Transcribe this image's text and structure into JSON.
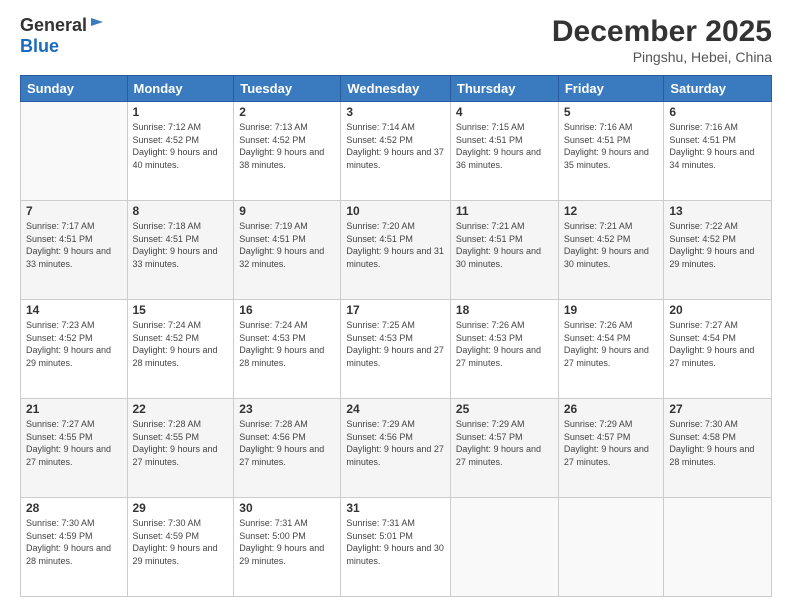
{
  "header": {
    "logo": {
      "general": "General",
      "blue": "Blue"
    },
    "title": "December 2025",
    "location": "Pingshu, Hebei, China"
  },
  "days_of_week": [
    "Sunday",
    "Monday",
    "Tuesday",
    "Wednesday",
    "Thursday",
    "Friday",
    "Saturday"
  ],
  "weeks": [
    [
      {
        "day": "",
        "sunrise": "",
        "sunset": "",
        "daylight": ""
      },
      {
        "day": "1",
        "sunrise": "Sunrise: 7:12 AM",
        "sunset": "Sunset: 4:52 PM",
        "daylight": "Daylight: 9 hours and 40 minutes."
      },
      {
        "day": "2",
        "sunrise": "Sunrise: 7:13 AM",
        "sunset": "Sunset: 4:52 PM",
        "daylight": "Daylight: 9 hours and 38 minutes."
      },
      {
        "day": "3",
        "sunrise": "Sunrise: 7:14 AM",
        "sunset": "Sunset: 4:52 PM",
        "daylight": "Daylight: 9 hours and 37 minutes."
      },
      {
        "day": "4",
        "sunrise": "Sunrise: 7:15 AM",
        "sunset": "Sunset: 4:51 PM",
        "daylight": "Daylight: 9 hours and 36 minutes."
      },
      {
        "day": "5",
        "sunrise": "Sunrise: 7:16 AM",
        "sunset": "Sunset: 4:51 PM",
        "daylight": "Daylight: 9 hours and 35 minutes."
      },
      {
        "day": "6",
        "sunrise": "Sunrise: 7:16 AM",
        "sunset": "Sunset: 4:51 PM",
        "daylight": "Daylight: 9 hours and 34 minutes."
      }
    ],
    [
      {
        "day": "7",
        "sunrise": "Sunrise: 7:17 AM",
        "sunset": "Sunset: 4:51 PM",
        "daylight": "Daylight: 9 hours and 33 minutes."
      },
      {
        "day": "8",
        "sunrise": "Sunrise: 7:18 AM",
        "sunset": "Sunset: 4:51 PM",
        "daylight": "Daylight: 9 hours and 33 minutes."
      },
      {
        "day": "9",
        "sunrise": "Sunrise: 7:19 AM",
        "sunset": "Sunset: 4:51 PM",
        "daylight": "Daylight: 9 hours and 32 minutes."
      },
      {
        "day": "10",
        "sunrise": "Sunrise: 7:20 AM",
        "sunset": "Sunset: 4:51 PM",
        "daylight": "Daylight: 9 hours and 31 minutes."
      },
      {
        "day": "11",
        "sunrise": "Sunrise: 7:21 AM",
        "sunset": "Sunset: 4:51 PM",
        "daylight": "Daylight: 9 hours and 30 minutes."
      },
      {
        "day": "12",
        "sunrise": "Sunrise: 7:21 AM",
        "sunset": "Sunset: 4:52 PM",
        "daylight": "Daylight: 9 hours and 30 minutes."
      },
      {
        "day": "13",
        "sunrise": "Sunrise: 7:22 AM",
        "sunset": "Sunset: 4:52 PM",
        "daylight": "Daylight: 9 hours and 29 minutes."
      }
    ],
    [
      {
        "day": "14",
        "sunrise": "Sunrise: 7:23 AM",
        "sunset": "Sunset: 4:52 PM",
        "daylight": "Daylight: 9 hours and 29 minutes."
      },
      {
        "day": "15",
        "sunrise": "Sunrise: 7:24 AM",
        "sunset": "Sunset: 4:52 PM",
        "daylight": "Daylight: 9 hours and 28 minutes."
      },
      {
        "day": "16",
        "sunrise": "Sunrise: 7:24 AM",
        "sunset": "Sunset: 4:53 PM",
        "daylight": "Daylight: 9 hours and 28 minutes."
      },
      {
        "day": "17",
        "sunrise": "Sunrise: 7:25 AM",
        "sunset": "Sunset: 4:53 PM",
        "daylight": "Daylight: 9 hours and 27 minutes."
      },
      {
        "day": "18",
        "sunrise": "Sunrise: 7:26 AM",
        "sunset": "Sunset: 4:53 PM",
        "daylight": "Daylight: 9 hours and 27 minutes."
      },
      {
        "day": "19",
        "sunrise": "Sunrise: 7:26 AM",
        "sunset": "Sunset: 4:54 PM",
        "daylight": "Daylight: 9 hours and 27 minutes."
      },
      {
        "day": "20",
        "sunrise": "Sunrise: 7:27 AM",
        "sunset": "Sunset: 4:54 PM",
        "daylight": "Daylight: 9 hours and 27 minutes."
      }
    ],
    [
      {
        "day": "21",
        "sunrise": "Sunrise: 7:27 AM",
        "sunset": "Sunset: 4:55 PM",
        "daylight": "Daylight: 9 hours and 27 minutes."
      },
      {
        "day": "22",
        "sunrise": "Sunrise: 7:28 AM",
        "sunset": "Sunset: 4:55 PM",
        "daylight": "Daylight: 9 hours and 27 minutes."
      },
      {
        "day": "23",
        "sunrise": "Sunrise: 7:28 AM",
        "sunset": "Sunset: 4:56 PM",
        "daylight": "Daylight: 9 hours and 27 minutes."
      },
      {
        "day": "24",
        "sunrise": "Sunrise: 7:29 AM",
        "sunset": "Sunset: 4:56 PM",
        "daylight": "Daylight: 9 hours and 27 minutes."
      },
      {
        "day": "25",
        "sunrise": "Sunrise: 7:29 AM",
        "sunset": "Sunset: 4:57 PM",
        "daylight": "Daylight: 9 hours and 27 minutes."
      },
      {
        "day": "26",
        "sunrise": "Sunrise: 7:29 AM",
        "sunset": "Sunset: 4:57 PM",
        "daylight": "Daylight: 9 hours and 27 minutes."
      },
      {
        "day": "27",
        "sunrise": "Sunrise: 7:30 AM",
        "sunset": "Sunset: 4:58 PM",
        "daylight": "Daylight: 9 hours and 28 minutes."
      }
    ],
    [
      {
        "day": "28",
        "sunrise": "Sunrise: 7:30 AM",
        "sunset": "Sunset: 4:59 PM",
        "daylight": "Daylight: 9 hours and 28 minutes."
      },
      {
        "day": "29",
        "sunrise": "Sunrise: 7:30 AM",
        "sunset": "Sunset: 4:59 PM",
        "daylight": "Daylight: 9 hours and 29 minutes."
      },
      {
        "day": "30",
        "sunrise": "Sunrise: 7:31 AM",
        "sunset": "Sunset: 5:00 PM",
        "daylight": "Daylight: 9 hours and 29 minutes."
      },
      {
        "day": "31",
        "sunrise": "Sunrise: 7:31 AM",
        "sunset": "Sunset: 5:01 PM",
        "daylight": "Daylight: 9 hours and 30 minutes."
      },
      {
        "day": "",
        "sunrise": "",
        "sunset": "",
        "daylight": ""
      },
      {
        "day": "",
        "sunrise": "",
        "sunset": "",
        "daylight": ""
      },
      {
        "day": "",
        "sunrise": "",
        "sunset": "",
        "daylight": ""
      }
    ]
  ]
}
